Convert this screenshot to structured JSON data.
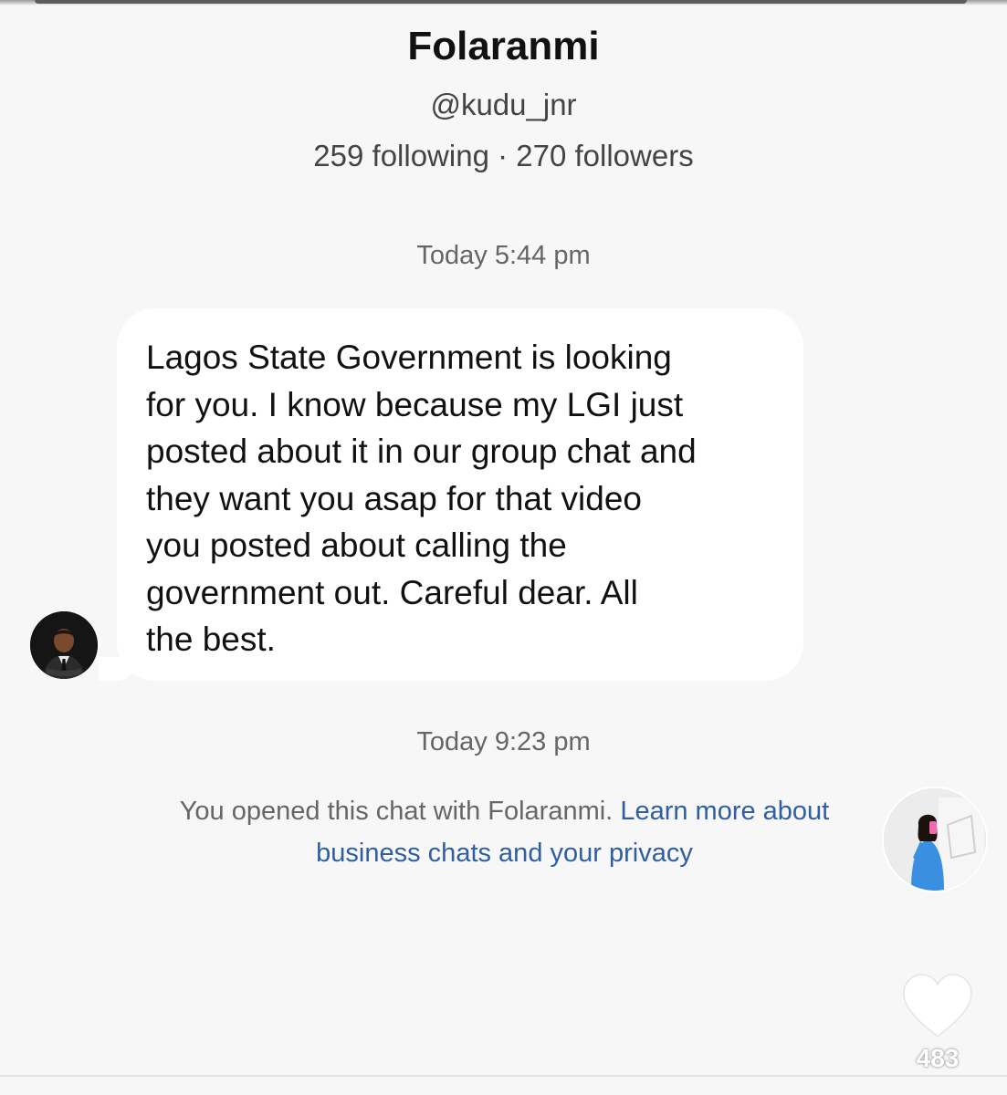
{
  "profile": {
    "name": "Folaranmi",
    "handle": "@kudu_jnr",
    "stats": "259 following · 270 followers"
  },
  "conversation": {
    "first_timestamp": "Today 5:44 pm",
    "message": {
      "lines": [
        "Lagos State Government is looking",
        "for you.  I know because my LGI just",
        "posted about it in our group chat and",
        "they want you asap for that video",
        "you posted about calling the",
        "government out. Careful dear.  All",
        "the best."
      ]
    },
    "second_timestamp": "Today 9:23 pm",
    "notice": {
      "text": "You opened this chat with Folaranmi.",
      "link_text": "Learn more about business chats and your privacy"
    }
  },
  "overlay": {
    "like_icon": "heart-icon",
    "like_count": "483"
  },
  "colors": {
    "background": "#f7f7f7",
    "bubble": "#ffffff",
    "link": "#2f5fa0",
    "secondary_text": "#666666"
  }
}
